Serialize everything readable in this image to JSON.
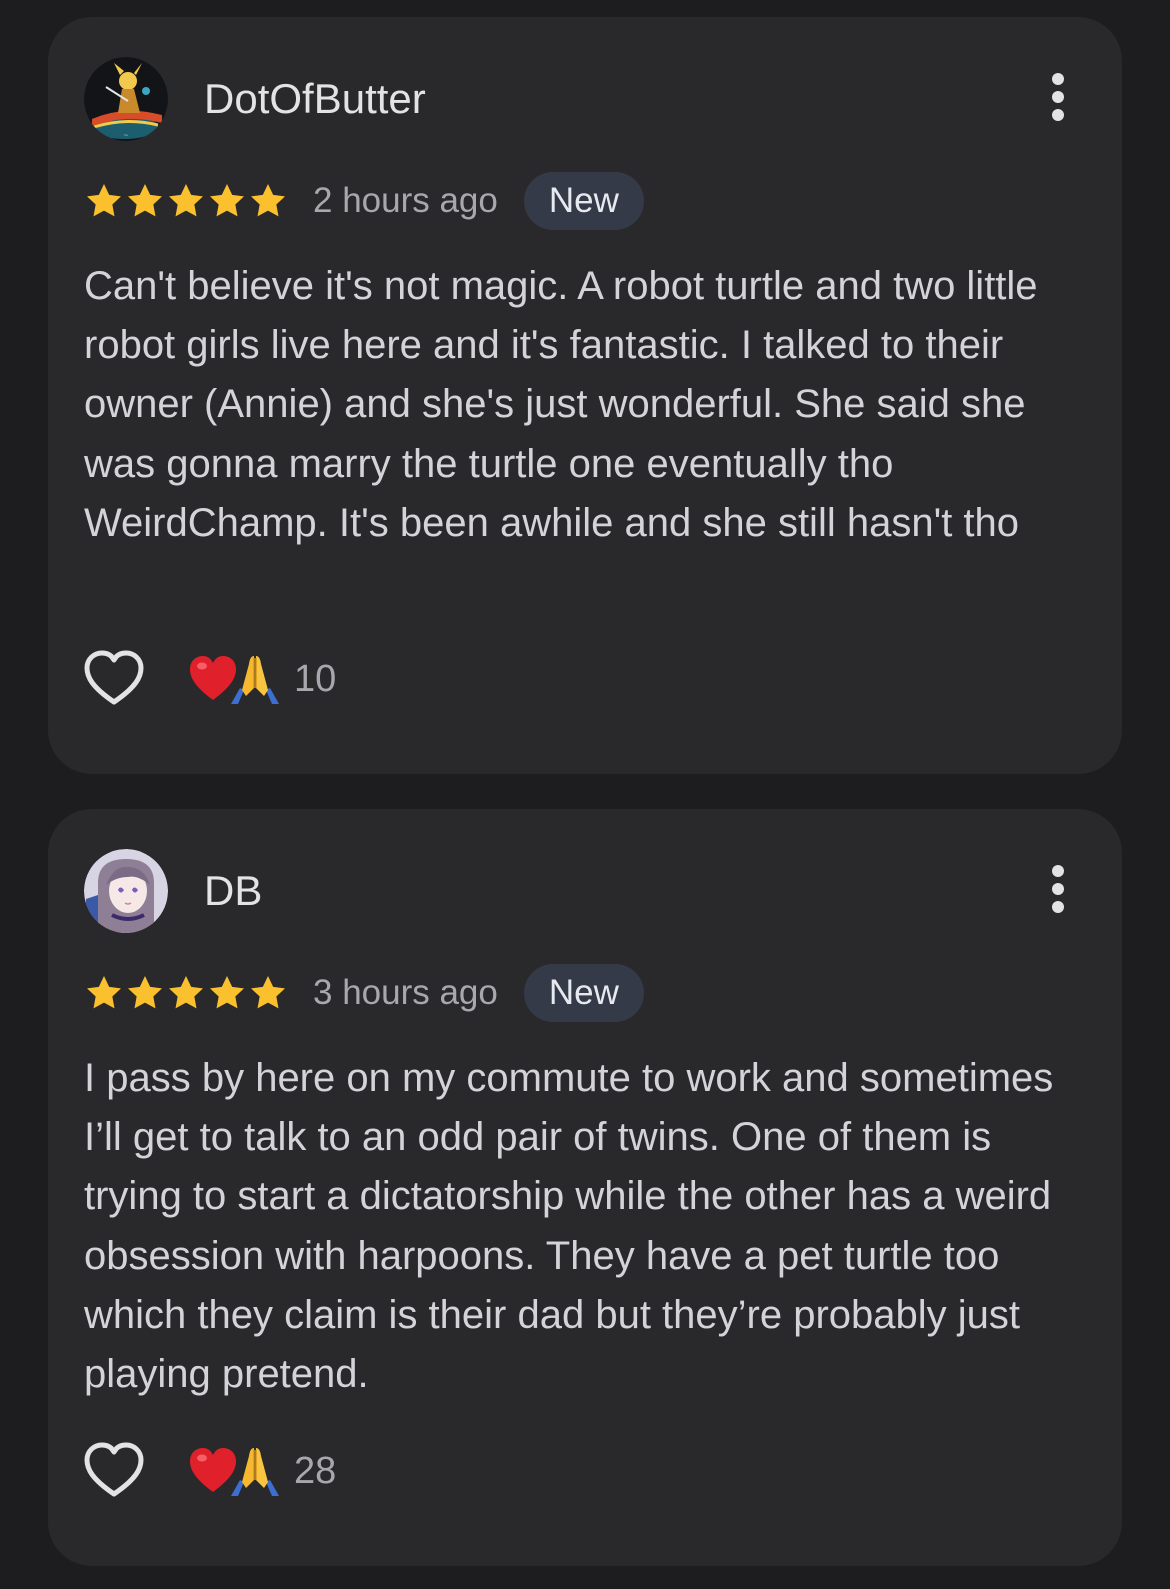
{
  "colors": {
    "background": "#1d1d1f",
    "card": "#29292c",
    "star": "#fbc02d",
    "badge_bg": "#343a48",
    "text_primary": "#e3e3e6",
    "text_secondary": "#a7a7ad"
  },
  "reviews": [
    {
      "author": "DotOfButter",
      "avatar_icon": "avatar-illustrated-character",
      "rating": 5,
      "time_ago": "2 hours ago",
      "badge": "New",
      "text": "Can't believe it's not magic. A robot turtle and two little robot girls live here and it's fantastic. I talked to their owner (Annie) and she's just wonderful. She said she was gonna marry the turtle one eventually tho WeirdChamp. It's been awhile and she still hasn't tho",
      "reactions": [
        "red-heart",
        "folded-hands"
      ],
      "reaction_count": "10"
    },
    {
      "author": "DB",
      "avatar_icon": "avatar-anime-girl",
      "rating": 5,
      "time_ago": "3 hours ago",
      "badge": "New",
      "text": "I pass by here on my commute to work and sometimes I’ll get to talk to an odd pair of twins. One of them is trying to start a dictatorship while the other has a weird obsession with harpoons. They have a pet turtle too which they claim is their dad but they’re probably just playing pretend.",
      "reactions": [
        "red-heart",
        "folded-hands"
      ],
      "reaction_count": "28"
    }
  ]
}
